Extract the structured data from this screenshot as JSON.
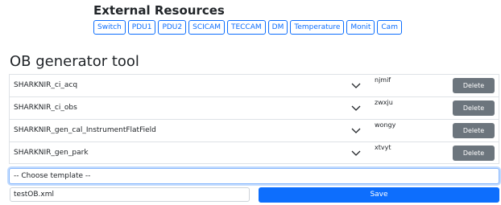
{
  "external_resources": {
    "title": "External Resources",
    "buttons": [
      "Switch",
      "PDU1",
      "PDU2",
      "SCICAM",
      "TECCAM",
      "DM",
      "Temperature",
      "Monit",
      "Cam"
    ]
  },
  "ob_generator": {
    "title": "OB generator tool",
    "rows": [
      {
        "name": "SHARKNIR_ci_acq",
        "note": "njmif",
        "delete_label": "Delete"
      },
      {
        "name": "SHARKNIR_ci_obs",
        "note": "zwxju",
        "delete_label": "Delete"
      },
      {
        "name": "SHARKNIR_gen_cal_InstrumentFlatField",
        "note": "wongy",
        "delete_label": "Delete"
      },
      {
        "name": "SHARKNIR_gen_park",
        "note": "xtvyt",
        "delete_label": "Delete"
      }
    ],
    "template_select": {
      "selected": "-- Choose template --"
    },
    "filename_input": {
      "value": "testOB.xml"
    },
    "save_label": "Save"
  },
  "colors": {
    "primary": "#0d6efd",
    "secondary": "#6c757d",
    "border": "#dee2e6"
  }
}
